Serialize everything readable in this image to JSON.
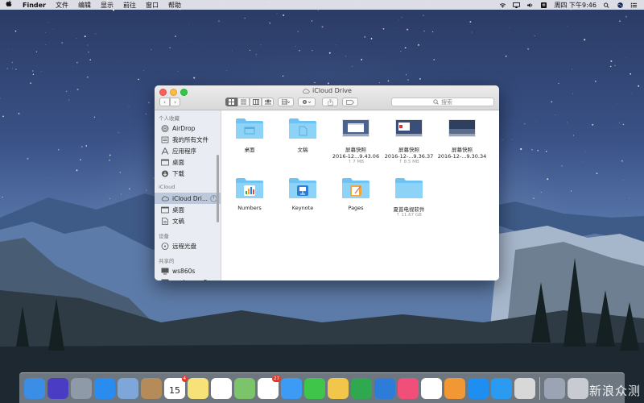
{
  "menubar": {
    "app_name": "Finder",
    "menus": [
      "文件",
      "编辑",
      "显示",
      "前往",
      "窗口",
      "帮助"
    ],
    "clock": "周四 下午9:46",
    "apple_icon": "apple-icon",
    "status_icons": [
      "wifi-icon",
      "airplay-icon",
      "volume-icon",
      "input-method-icon",
      "search-icon",
      "siri-icon",
      "notification-center-icon"
    ]
  },
  "window": {
    "title": "iCloud Drive",
    "search_placeholder": "搜索",
    "sidebar": {
      "sections": [
        {
          "header": "个人收藏",
          "items": [
            {
              "label": "AirDrop",
              "icon": "airdrop-icon"
            },
            {
              "label": "我的所有文件",
              "icon": "all-files-icon"
            },
            {
              "label": "应用程序",
              "icon": "applications-icon"
            },
            {
              "label": "桌面",
              "icon": "desktop-icon"
            },
            {
              "label": "下载",
              "icon": "downloads-icon"
            }
          ]
        },
        {
          "header": "iCloud",
          "items": [
            {
              "label": "iCloud Dri...",
              "icon": "icloud-icon",
              "selected": true
            },
            {
              "label": "桌面",
              "icon": "desktop-icon"
            },
            {
              "label": "文稿",
              "icon": "documents-icon"
            }
          ]
        },
        {
          "header": "设备",
          "items": [
            {
              "label": "远程光盘",
              "icon": "remote-disc-icon"
            }
          ]
        },
        {
          "header": "共享的",
          "items": [
            {
              "label": "ws860s",
              "icon": "computer-icon"
            },
            {
              "label": "wuduoqoo5c",
              "icon": "computer-icon"
            }
          ]
        }
      ]
    },
    "files": [
      {
        "name": "桌面",
        "sub": "",
        "size": "",
        "icon": "folder-icon"
      },
      {
        "name": "文稿",
        "sub": "",
        "size": "",
        "icon": "folder-icon"
      },
      {
        "name": "屏幕快照",
        "sub": "2016-12...9.43.06",
        "size": "↑ 7 MB",
        "icon": "screenshot-thumbnail"
      },
      {
        "name": "屏幕快照",
        "sub": "2016-12-...9.36.37",
        "size": "↑ 8.5 MB",
        "icon": "screenshot-thumbnail"
      },
      {
        "name": "屏幕快照",
        "sub": "2016-12-...9.30.34",
        "size": "",
        "icon": "screenshot-thumbnail"
      },
      {
        "name": "Numbers",
        "sub": "",
        "size": "",
        "icon": "numbers-folder-icon"
      },
      {
        "name": "Keynote",
        "sub": "",
        "size": "",
        "icon": "keynote-folder-icon"
      },
      {
        "name": "Pages",
        "sub": "",
        "size": "",
        "icon": "pages-folder-icon"
      },
      {
        "name": "夏普电视软件",
        "sub": "",
        "size": "↑ 11.67 GB",
        "icon": "folder-icon"
      }
    ]
  },
  "dock": {
    "items": [
      {
        "name": "finder-icon",
        "color": "#3a8ee6"
      },
      {
        "name": "siri-icon",
        "color": "#4b3cc4"
      },
      {
        "name": "launchpad-icon",
        "color": "#8e9aa8"
      },
      {
        "name": "safari-icon",
        "color": "#2b8cf0"
      },
      {
        "name": "mail-stamp-icon",
        "color": "#7fa6d8"
      },
      {
        "name": "contacts-icon",
        "color": "#b58b5a"
      },
      {
        "name": "calendar-icon",
        "color": "#ffffff",
        "text": "15",
        "badge": "4"
      },
      {
        "name": "notes-icon",
        "color": "#f7e27a"
      },
      {
        "name": "reminders-icon",
        "color": "#ffffff"
      },
      {
        "name": "maps-icon",
        "color": "#7cc46a"
      },
      {
        "name": "photos-icon",
        "color": "#ffffff",
        "badge": "27"
      },
      {
        "name": "messages-icon",
        "color": "#3d9bf5"
      },
      {
        "name": "facetime-icon",
        "color": "#3fc64a"
      },
      {
        "name": "preview-icon",
        "color": "#f2c54b"
      },
      {
        "name": "numbers-icon",
        "color": "#2fa84f"
      },
      {
        "name": "keynote-icon",
        "color": "#2c7cd8"
      },
      {
        "name": "itunes-icon",
        "color": "#ef4f78"
      },
      {
        "name": "qq-icon",
        "color": "#ffffff"
      },
      {
        "name": "ibooks-icon",
        "color": "#f19733"
      },
      {
        "name": "app-store-icon",
        "color": "#1e8ef0"
      },
      {
        "name": "pen-app-icon",
        "color": "#2b9bf1"
      },
      {
        "name": "stickies-icon",
        "color": "#d8d8d8"
      },
      {
        "name": "downloads-stack-icon",
        "color": "#9aa4b4"
      },
      {
        "name": "trash-icon",
        "color": "#c8ccd2"
      }
    ]
  },
  "watermark": "新浪众测"
}
